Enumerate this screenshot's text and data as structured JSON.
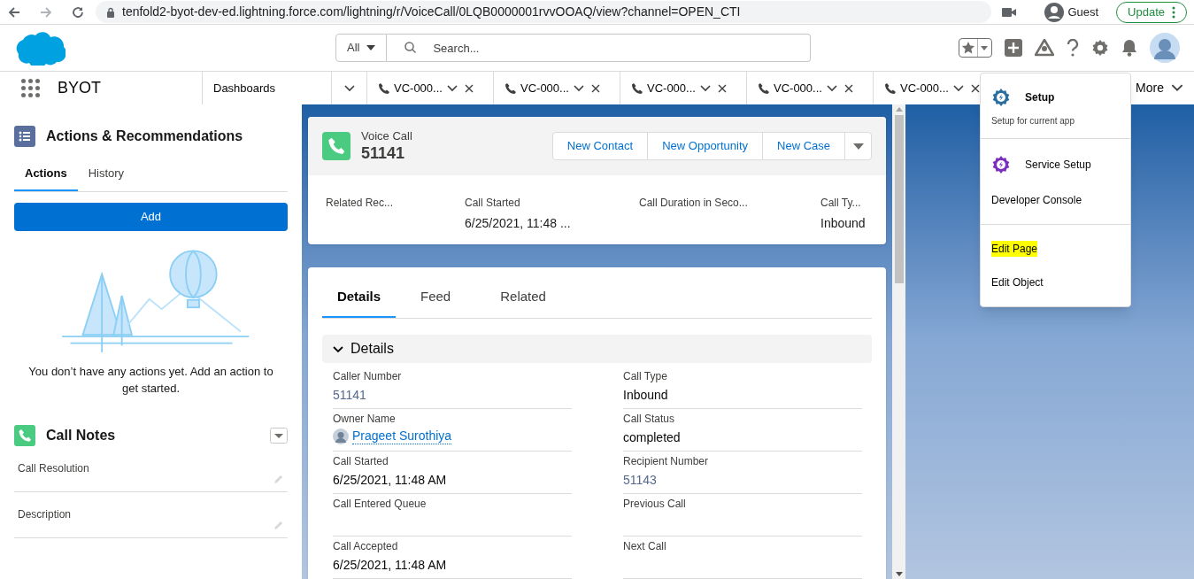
{
  "browser": {
    "url": "tenfold2-byot-dev-ed.lightning.force.com/lightning/r/VoiceCall/0LQB0000001rvvOOAQ/view?channel=OPEN_CTI",
    "profile": "Guest",
    "update_button": "Update"
  },
  "header": {
    "search_scope": "All",
    "search_placeholder": "Search..."
  },
  "nav": {
    "app_name": "BYOT",
    "tabs": [
      {
        "label": "Dashboards",
        "kind": "object"
      },
      {
        "label": "VC-000...",
        "kind": "record"
      },
      {
        "label": "VC-000...",
        "kind": "record"
      },
      {
        "label": "VC-000...",
        "kind": "record"
      },
      {
        "label": "VC-000...",
        "kind": "record"
      },
      {
        "label": "VC-000...",
        "kind": "record"
      }
    ],
    "more": "More"
  },
  "actions_panel": {
    "title": "Actions & Recommendations",
    "tabs": [
      {
        "label": "Actions",
        "selected": true
      },
      {
        "label": "History",
        "selected": false
      }
    ],
    "add_button": "Add",
    "empty_message": "You don’t have any actions yet. Add an action to get started."
  },
  "call_notes": {
    "title": "Call Notes",
    "fields": [
      {
        "label": "Call Resolution"
      },
      {
        "label": "Description"
      }
    ]
  },
  "record": {
    "object": "Voice Call",
    "name": "51141",
    "actions": [
      "New Contact",
      "New Opportunity",
      "New Case"
    ],
    "highlights": [
      {
        "label": "Related Rec..."
      },
      {
        "label": "Call Started",
        "value": "6/25/2021, 11:48 ..."
      },
      {
        "label": "Call Duration in Seco..."
      },
      {
        "label": "Call Ty...",
        "value": "Inbound"
      }
    ]
  },
  "detail_tabs": [
    {
      "label": "Details",
      "selected": true
    },
    {
      "label": "Feed",
      "selected": false
    },
    {
      "label": "Related",
      "selected": false
    }
  ],
  "section": {
    "title": "Details",
    "expanded": true
  },
  "fields": [
    {
      "label": "Caller Number",
      "value": "51141",
      "kind": "phone"
    },
    {
      "label": "Call Type",
      "value": "Inbound",
      "kind": "text"
    },
    {
      "label": "Owner Name",
      "value": "Prageet Surothiya",
      "kind": "user"
    },
    {
      "label": "Call Status",
      "value": "completed",
      "kind": "text"
    },
    {
      "label": "Call Started",
      "value": "6/25/2021, 11:48 AM",
      "kind": "text"
    },
    {
      "label": "Recipient Number",
      "value": "51143",
      "kind": "phone"
    },
    {
      "label": "Call Entered Queue",
      "kind": "text"
    },
    {
      "label": "Previous Call",
      "kind": "text"
    },
    {
      "label": "Call Accepted",
      "value": "6/25/2021, 11:48 AM",
      "kind": "text"
    },
    {
      "label": "Next Call",
      "kind": "text"
    }
  ],
  "menu": [
    {
      "label": "Setup",
      "subtitle": "Setup for current app",
      "kind": "setup",
      "color": "#2a6f9e",
      "highlighted": false
    },
    {
      "label": "Service Setup",
      "kind": "setup",
      "color": "#7b2fbf",
      "highlighted": false
    },
    {
      "label": "Developer Console",
      "kind": "plain",
      "highlighted": false
    },
    {
      "label": "Edit Page",
      "kind": "plain",
      "highlighted": true,
      "divider_before": true
    },
    {
      "label": "Edit Object",
      "kind": "plain",
      "highlighted": false
    }
  ]
}
